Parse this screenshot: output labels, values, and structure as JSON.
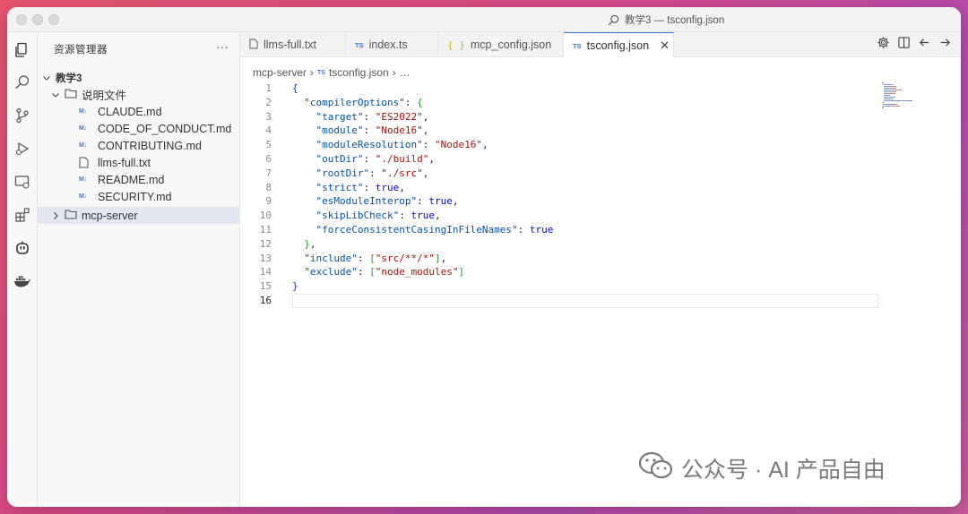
{
  "window": {
    "title": "教学3 — tsconfig.json"
  },
  "sidebar": {
    "header": "资源管理器",
    "more": "···",
    "tree": [
      {
        "label": "教学3",
        "type": "root",
        "icon": "chevron-down-icon"
      },
      {
        "label": "说明文件",
        "type": "folder-open",
        "icon": "folder-icon"
      },
      {
        "label": "CLAUDE.md",
        "type": "md",
        "icon": "markdown-icon"
      },
      {
        "label": "CODE_OF_CONDUCT.md",
        "type": "md",
        "icon": "markdown-icon"
      },
      {
        "label": "CONTRIBUTING.md",
        "type": "md",
        "icon": "markdown-icon"
      },
      {
        "label": "llms-full.txt",
        "type": "txt",
        "icon": "file-icon"
      },
      {
        "label": "README.md",
        "type": "md",
        "icon": "markdown-icon"
      },
      {
        "label": "SECURITY.md",
        "type": "md",
        "icon": "markdown-icon"
      },
      {
        "label": "mcp-server",
        "type": "folder-closed",
        "icon": "folder-icon",
        "selected": true
      }
    ],
    "md_badge": "M↓"
  },
  "tabs": [
    {
      "label": "llms-full.txt",
      "icon": "file-icon"
    },
    {
      "label": "index.ts",
      "icon": "ts-icon",
      "badge": "TS"
    },
    {
      "label": "mcp_config.json",
      "icon": "json-icon",
      "badge": "{ }"
    },
    {
      "label": "tsconfig.json",
      "icon": "ts-config-icon",
      "badge": "TS",
      "active": true,
      "close": "✕"
    }
  ],
  "breadcrumb": {
    "folder": "mcp-server",
    "file": "tsconfig.json",
    "more": "…",
    "sep": "›"
  },
  "code": {
    "line_numbers": [
      "1",
      "2",
      "3",
      "4",
      "5",
      "6",
      "7",
      "8",
      "9",
      "10",
      "11",
      "12",
      "13",
      "14",
      "15",
      "16"
    ],
    "lines": [
      [
        {
          "t": "{",
          "c": "p1"
        }
      ],
      [
        {
          "t": "  "
        },
        {
          "t": "\"compilerOptions\"",
          "c": "k"
        },
        {
          "t": ": "
        },
        {
          "t": "{",
          "c": "p2"
        }
      ],
      [
        {
          "t": "    "
        },
        {
          "t": "\"target\"",
          "c": "k"
        },
        {
          "t": ": "
        },
        {
          "t": "\"ES2022\"",
          "c": "s"
        },
        {
          "t": ","
        }
      ],
      [
        {
          "t": "    "
        },
        {
          "t": "\"module\"",
          "c": "k"
        },
        {
          "t": ": "
        },
        {
          "t": "\"Node16\"",
          "c": "s"
        },
        {
          "t": ","
        }
      ],
      [
        {
          "t": "    "
        },
        {
          "t": "\"moduleResolution\"",
          "c": "k"
        },
        {
          "t": ": "
        },
        {
          "t": "\"Node16\"",
          "c": "s"
        },
        {
          "t": ","
        }
      ],
      [
        {
          "t": "    "
        },
        {
          "t": "\"outDir\"",
          "c": "k"
        },
        {
          "t": ": "
        },
        {
          "t": "\"./build\"",
          "c": "s"
        },
        {
          "t": ","
        }
      ],
      [
        {
          "t": "    "
        },
        {
          "t": "\"rootDir\"",
          "c": "k"
        },
        {
          "t": ": "
        },
        {
          "t": "\"./src\"",
          "c": "s"
        },
        {
          "t": ","
        }
      ],
      [
        {
          "t": "    "
        },
        {
          "t": "\"strict\"",
          "c": "k"
        },
        {
          "t": ": "
        },
        {
          "t": "true",
          "c": "b"
        },
        {
          "t": ","
        }
      ],
      [
        {
          "t": "    "
        },
        {
          "t": "\"esModuleInterop\"",
          "c": "k"
        },
        {
          "t": ": "
        },
        {
          "t": "true",
          "c": "b"
        },
        {
          "t": ","
        }
      ],
      [
        {
          "t": "    "
        },
        {
          "t": "\"skipLibCheck\"",
          "c": "k"
        },
        {
          "t": ": "
        },
        {
          "t": "true",
          "c": "b"
        },
        {
          "t": ","
        }
      ],
      [
        {
          "t": "    "
        },
        {
          "t": "\"forceConsistentCasingInFileNames\"",
          "c": "k"
        },
        {
          "t": ": "
        },
        {
          "t": "true",
          "c": "b"
        }
      ],
      [
        {
          "t": "  "
        },
        {
          "t": "}",
          "c": "p2"
        },
        {
          "t": ","
        }
      ],
      [
        {
          "t": "  "
        },
        {
          "t": "\"include\"",
          "c": "k"
        },
        {
          "t": ": "
        },
        {
          "t": "[",
          "c": "p2"
        },
        {
          "t": "\"src/**/*\"",
          "c": "s"
        },
        {
          "t": "]",
          "c": "p2"
        },
        {
          "t": ","
        }
      ],
      [
        {
          "t": "  "
        },
        {
          "t": "\"exclude\"",
          "c": "k"
        },
        {
          "t": ": "
        },
        {
          "t": "[",
          "c": "p2"
        },
        {
          "t": "\"node_modules\"",
          "c": "s"
        },
        {
          "t": "]",
          "c": "p2"
        }
      ],
      [
        {
          "t": "}",
          "c": "p1"
        }
      ],
      []
    ]
  },
  "watermark": {
    "text": "公众号 · AI 产品自由"
  },
  "colors": {
    "accent": "#3b7ad8",
    "key": "#0451a5",
    "string": "#a31515",
    "boolean": "#0000ff"
  }
}
